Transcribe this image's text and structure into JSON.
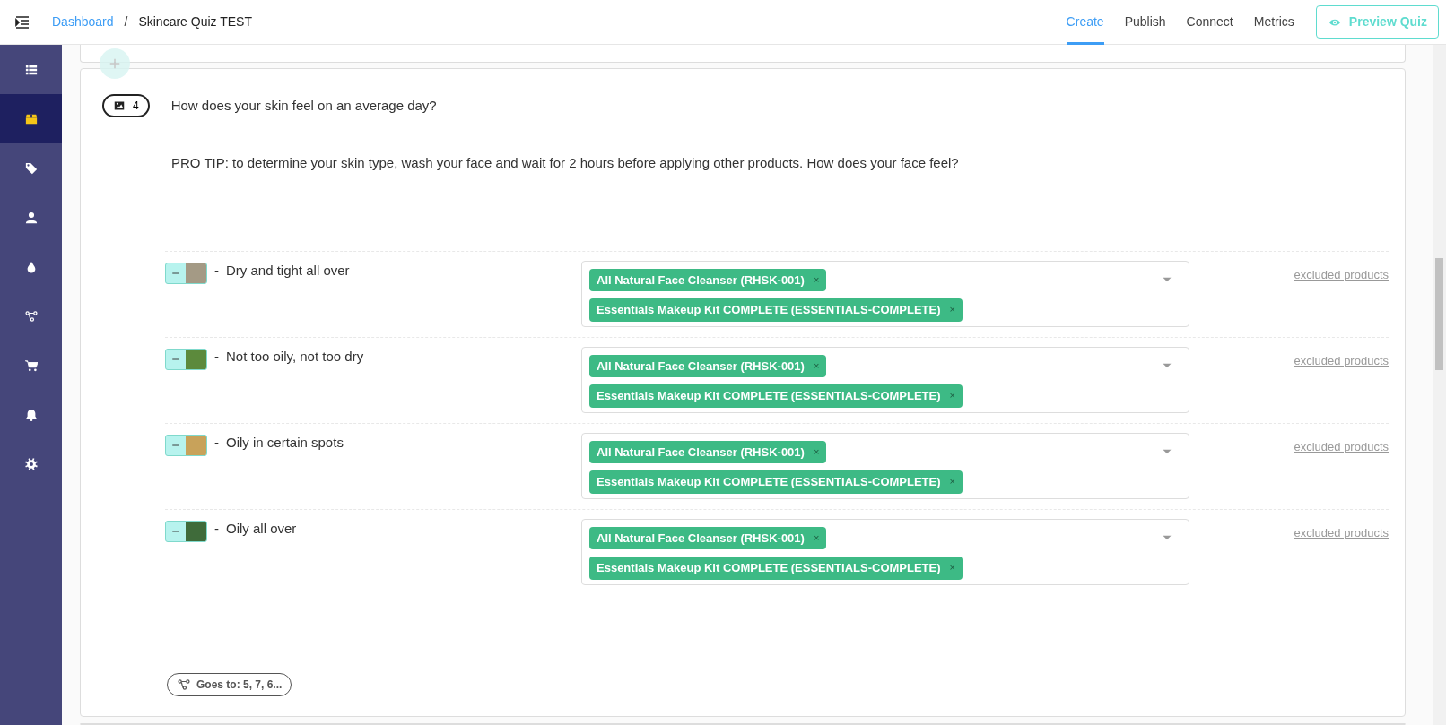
{
  "header": {
    "breadcrumb": [
      {
        "label": "Dashboard",
        "kind": "link"
      },
      {
        "label": "Skincare Quiz TEST",
        "kind": "text"
      }
    ],
    "breadcrumb_separator": "/",
    "tabs": [
      {
        "label": "Create",
        "selected": true
      },
      {
        "label": "Publish",
        "selected": false
      },
      {
        "label": "Connect",
        "selected": false
      },
      {
        "label": "Metrics",
        "selected": false
      }
    ],
    "preview_button": "Preview Quiz"
  },
  "sidebar": {
    "items": [
      {
        "selected": false
      },
      {
        "selected": true
      },
      {
        "selected": false
      },
      {
        "selected": false
      },
      {
        "selected": false
      },
      {
        "selected": false
      },
      {
        "selected": false
      },
      {
        "selected": false
      },
      {
        "selected": false
      }
    ]
  },
  "question": {
    "media_count": "4",
    "title": "How does your skin feel on an average day?",
    "tip": "PRO TIP: to determine your skin type, wash your face and wait for 2 hours before applying other products. How does your face feel?",
    "answers": [
      {
        "marker": "-",
        "label": "Dry and tight all over",
        "products": [
          {
            "name": "All Natural Face Cleanser (RHSK-001)",
            "remove": "×"
          },
          {
            "name": "Essentials Makeup Kit COMPLETE (ESSENTIALS-COMPLETE)",
            "remove": "×"
          }
        ],
        "link": "excluded products"
      },
      {
        "marker": "-",
        "label": "Not too oily, not too dry",
        "products": [
          {
            "name": "All Natural Face Cleanser (RHSK-001)",
            "remove": "×"
          },
          {
            "name": "Essentials Makeup Kit COMPLETE (ESSENTIALS-COMPLETE)",
            "remove": "×"
          }
        ],
        "link": "excluded products"
      },
      {
        "marker": "-",
        "label": "Oily in certain spots",
        "products": [
          {
            "name": "All Natural Face Cleanser (RHSK-001)",
            "remove": "×"
          },
          {
            "name": "Essentials Makeup Kit COMPLETE (ESSENTIALS-COMPLETE)",
            "remove": "×"
          }
        ],
        "link": "excluded products"
      },
      {
        "marker": "-",
        "label": "Oily all over",
        "products": [
          {
            "name": "All Natural Face Cleanser (RHSK-001)",
            "remove": "×"
          },
          {
            "name": "Essentials Makeup Kit COMPLETE (ESSENTIALS-COMPLETE)",
            "remove": "×"
          }
        ],
        "link": "excluded products"
      }
    ],
    "goes_to": "Goes to: 5, 7, 6..."
  }
}
